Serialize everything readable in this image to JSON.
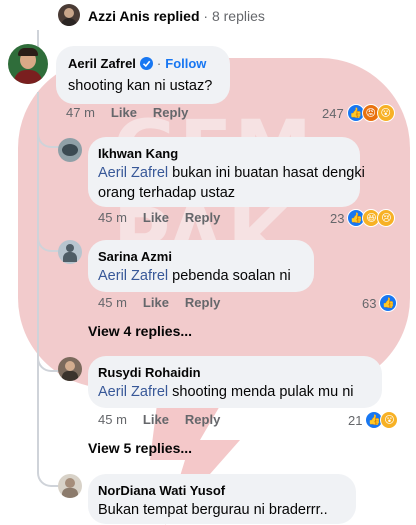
{
  "top": {
    "name": "Azzi Anis",
    "suffix": "replied",
    "dot": "·",
    "count": "8 replies"
  },
  "comments": {
    "main": {
      "name": "Aeril Zafrel",
      "dot": "·",
      "follow": "Follow",
      "text": "shooting kan ni ustaz?",
      "time": "47 m",
      "like": "Like",
      "reply": "Reply",
      "reactions": "247"
    },
    "r1": {
      "name": "Ikhwan Kang",
      "mention": "Aeril Zafrel",
      "text_line1": "bukan ini buatan hasat dengki",
      "text_line2": "orang terhadap ustaz",
      "time": "45 m",
      "like": "Like",
      "reply": "Reply",
      "reactions": "23"
    },
    "r2": {
      "name": "Sarina Azmi",
      "mention": "Aeril Zafrel",
      "text": "pebenda soalan ni",
      "time": "45 m",
      "like": "Like",
      "reply": "Reply",
      "reactions": "63"
    },
    "view4": "View 4 replies...",
    "r3": {
      "name": "Rusydi Rohaidin",
      "mention": "Aeril Zafrel",
      "text": "shooting menda pulak mu ni",
      "time": "45 m",
      "like": "Like",
      "reply": "Reply",
      "reactions": "21"
    },
    "view5": "View 5 replies...",
    "r4": {
      "name": "NorDiana Wati Yusof",
      "text": "Bukan tempat bergurau ni braderrr.."
    }
  },
  "icons": [
    "like-icon",
    "angry-icon",
    "wow-icon",
    "haha-icon",
    "sad-icon",
    "verified-badge-icon"
  ],
  "colors": {
    "link": "#385898",
    "follow": "#1877f2",
    "bubble": "#f0f2f5",
    "meta": "#65676b"
  }
}
